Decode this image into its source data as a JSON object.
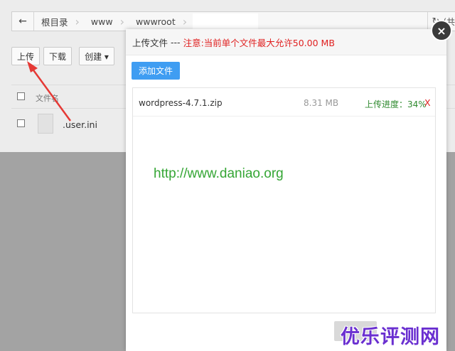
{
  "breadcrumb": {
    "back_icon": "←",
    "items": [
      "根目录",
      "www",
      "wwwroot"
    ],
    "refresh_icon": "↻",
    "overflow_text": "(共"
  },
  "toolbar": {
    "upload_label": "上传",
    "download_label": "下载",
    "create_label": "创建 ▾"
  },
  "table": {
    "header_label": "文件名",
    "rows": [
      {
        "name": ".user.ini"
      }
    ]
  },
  "modal": {
    "title": "上传文件",
    "separator": "---",
    "notice": "注意:当前单个文件最大允许50.00 MB",
    "add_button_label": "添加文件",
    "close_icon": "×",
    "uploads": [
      {
        "name": "wordpress-4.7.1.zip",
        "size": "8.31 MB",
        "progress_text": "上传进度：34%",
        "remove_label": "X"
      }
    ]
  },
  "watermark": {
    "url": "http://www.daniao.org",
    "brand": "优乐评测网"
  },
  "colors": {
    "notice": "#e02020",
    "primary_button": "#3f9df2",
    "progress": "#2f8a2f",
    "annotation_arrow": "#e53935",
    "watermark_url": "#35a635",
    "watermark_brand": "#6a2fd0"
  }
}
